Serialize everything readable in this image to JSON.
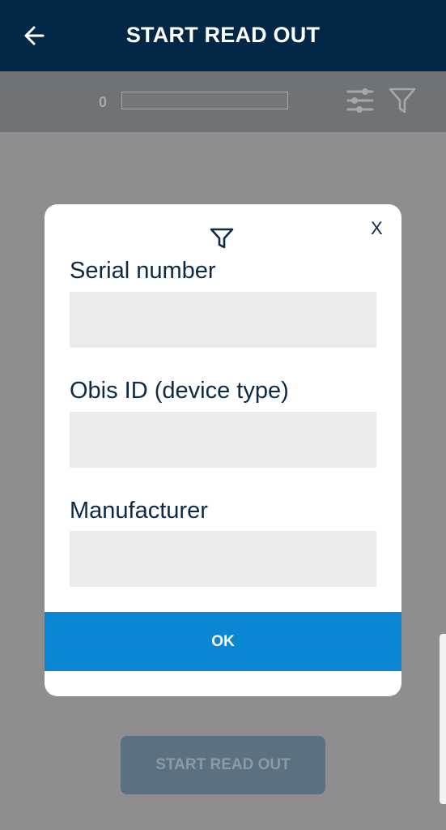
{
  "appbar": {
    "title": "START READ OUT",
    "back_icon": "arrow-left-icon"
  },
  "toolbar": {
    "count": "0",
    "progress": 0,
    "settings_icon": "sliders-icon",
    "filter_icon": "filter-icon"
  },
  "dialog": {
    "filter_icon": "filter-icon",
    "close_label": "X",
    "fields": [
      {
        "label": "Serial number",
        "value": ""
      },
      {
        "label": "Obis ID (device type)",
        "value": ""
      },
      {
        "label": "Manufacturer",
        "value": ""
      }
    ],
    "ok_label": "OK"
  },
  "bottom": {
    "start_label": "START READ OUT"
  },
  "colors": {
    "appbar": "#032847",
    "accent": "#0a87d2",
    "overlay": "#8e8d8f"
  }
}
